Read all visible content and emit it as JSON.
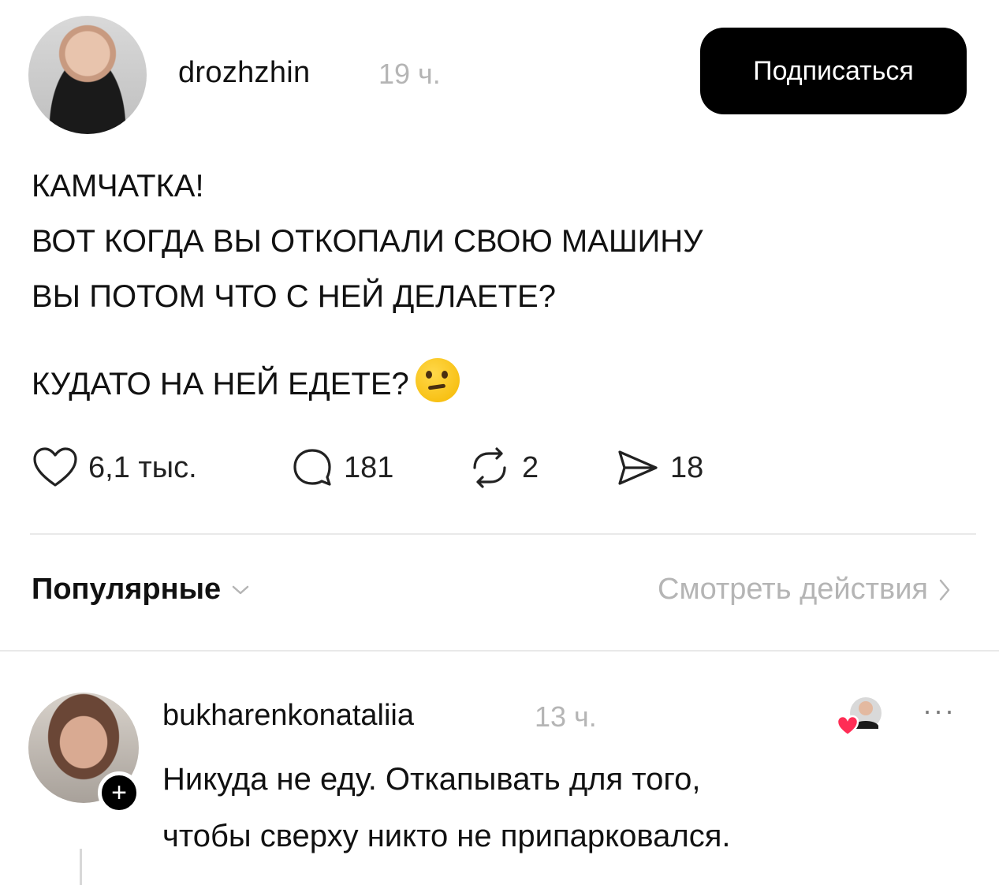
{
  "post": {
    "username": "drozhzhin",
    "time": "19 ч.",
    "follow_label": "Подписаться",
    "lines": [
      "КАМЧАТКА!",
      "ВОТ КОГДА ВЫ ОТКОПАЛИ СВОЮ МАШИНУ",
      "ВЫ ПОТОМ ЧТО С НЕЙ ДЕЛАЕТЕ?",
      "КУДАТО НА НЕЙ ЕДЕТЕ?"
    ],
    "emoji": "thinking-face"
  },
  "actions": {
    "likes": "6,1 тыс.",
    "comments": "181",
    "reposts": "2",
    "shares": "18"
  },
  "sort": {
    "label": "Популярные",
    "view_actions": "Смотреть действия"
  },
  "comment": {
    "username": "bukharenkonataliia",
    "time": "13 ч.",
    "lines": [
      "Никуда не еду. Откапывать для того,",
      "чтобы сверху никто не припарковался."
    ],
    "more": "···"
  }
}
